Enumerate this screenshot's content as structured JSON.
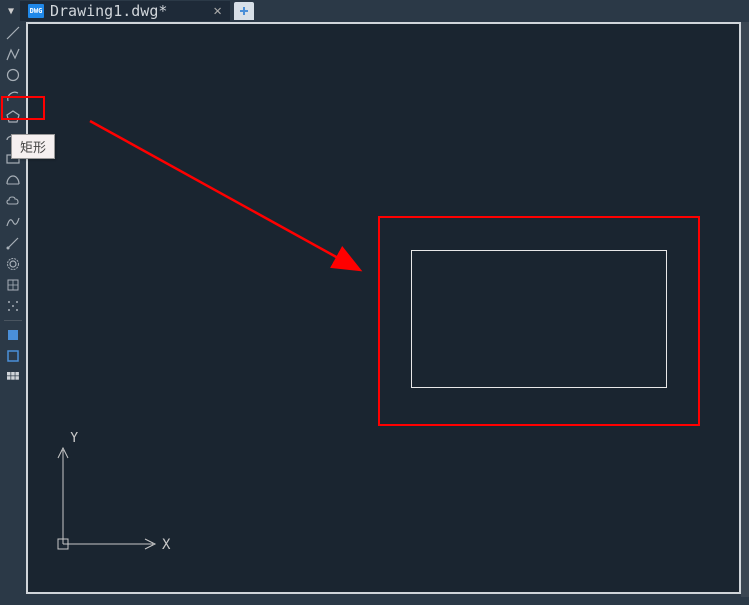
{
  "tabs": {
    "dropdown_glyph": "▼",
    "active": {
      "icon_text": "DWG",
      "title": "Drawing1.dwg*",
      "close_glyph": "✕"
    }
  },
  "tooltip": {
    "rectangle": "矩形"
  },
  "ucs": {
    "x_label": "X",
    "y_label": "Y"
  },
  "tools": [
    "line",
    "polyline",
    "circle",
    "arc-cw",
    "polygon",
    "ellipse-arc",
    "rectangle",
    "ellipse-half",
    "cloud",
    "spline",
    "ray",
    "gear",
    "hatch-grid",
    "point-grid",
    "solid-fill",
    "solid-box",
    "table"
  ]
}
